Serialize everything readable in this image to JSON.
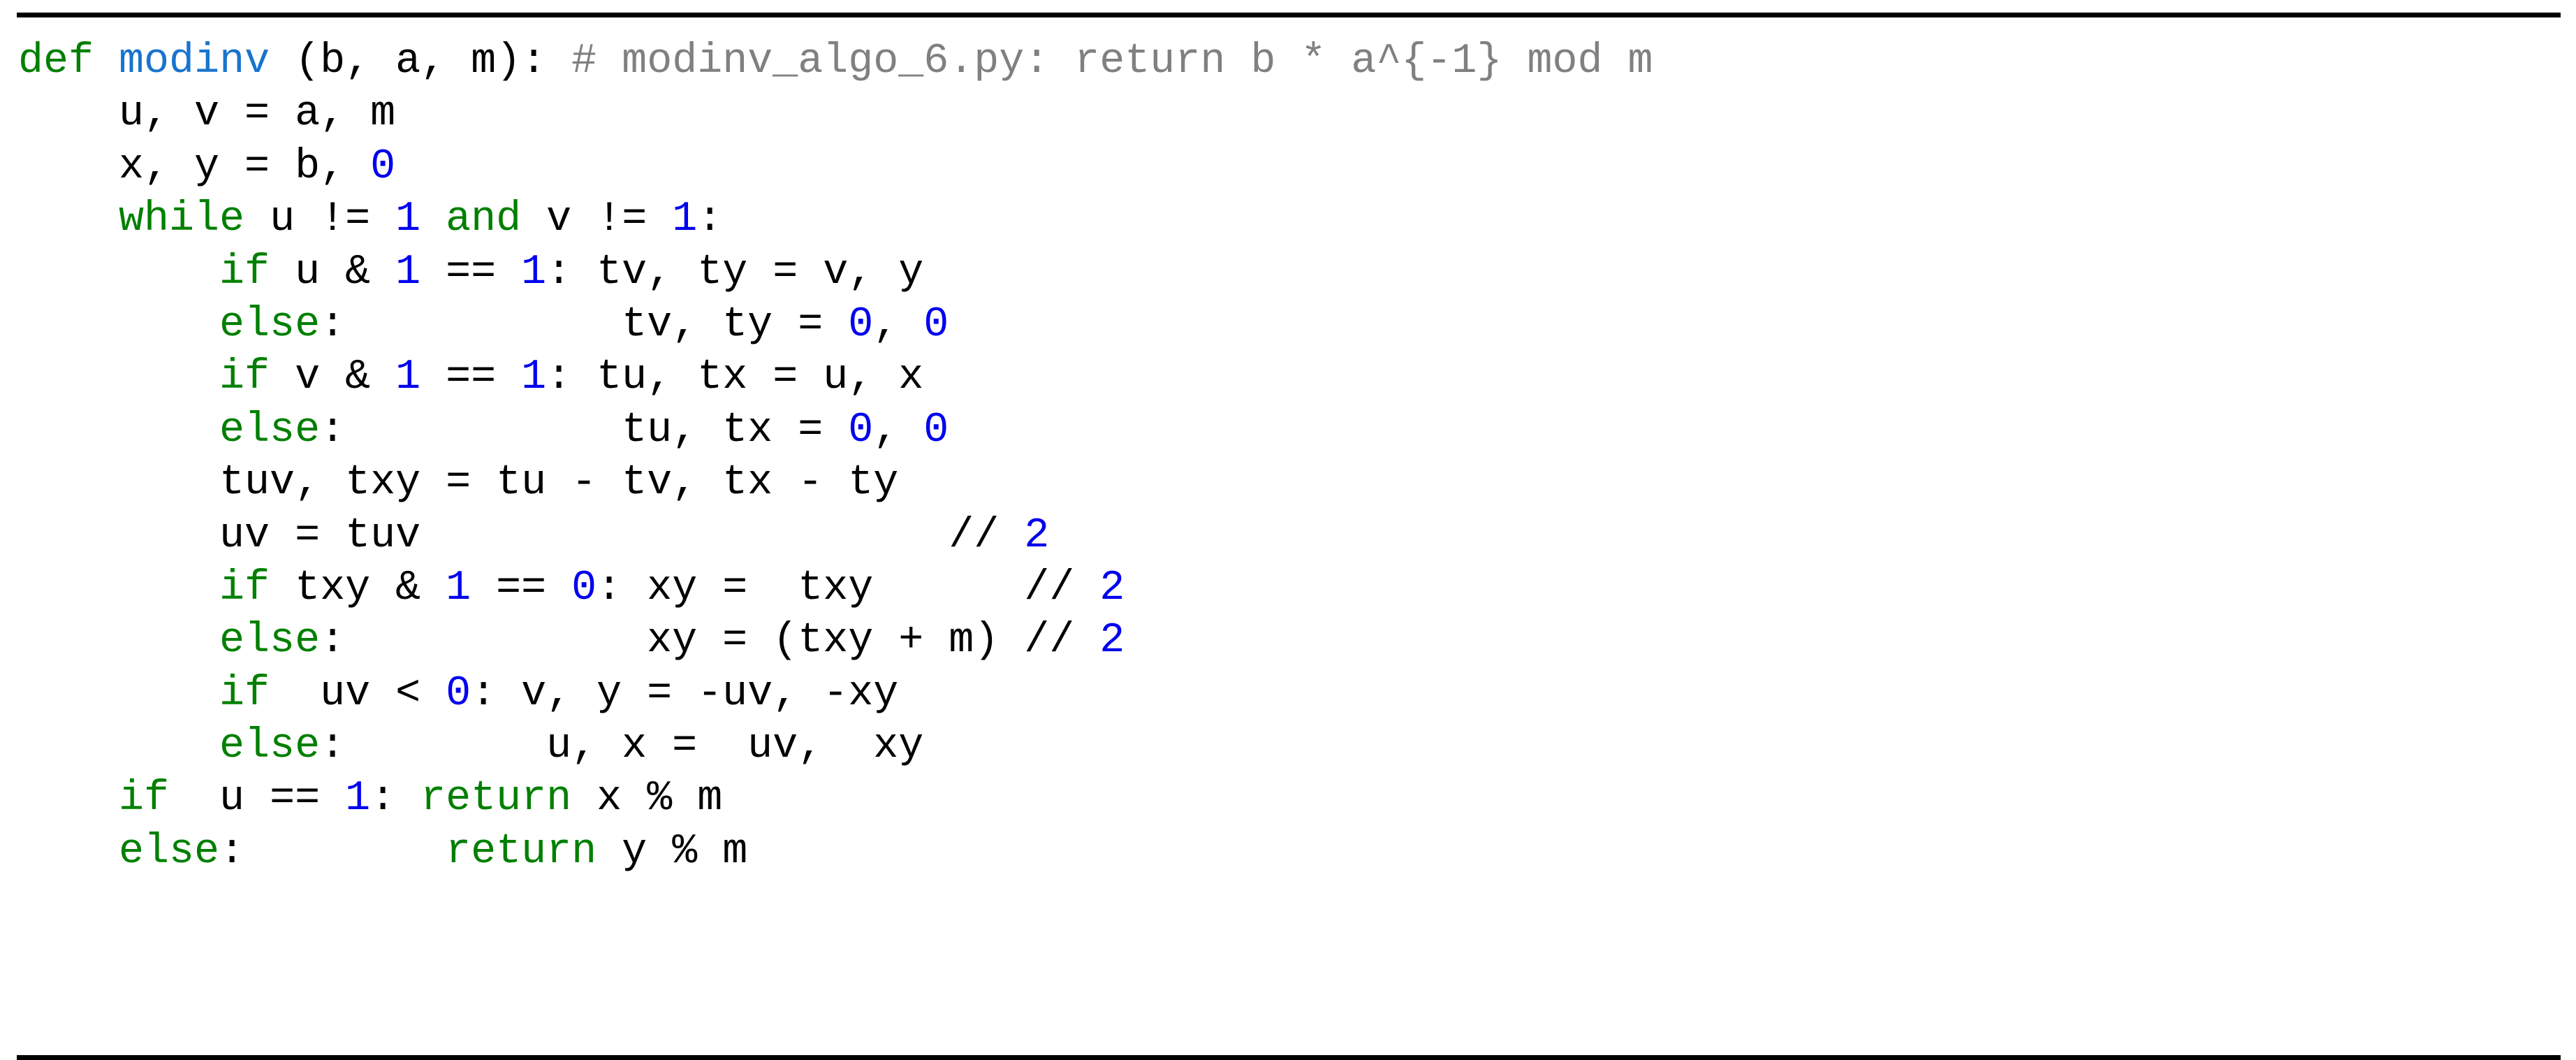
{
  "listing": {
    "language": "python",
    "caption": "",
    "colors": {
      "keyword": "#007f00",
      "function_name": "#1874cd",
      "number": "#0000ee",
      "comment": "#808080",
      "identifier": "#000000",
      "rule": "#000000",
      "background": "#ffffff"
    },
    "rules": {
      "top": "─",
      "bottom": "─"
    },
    "lines": [
      {
        "id": "line-1",
        "indent": 0,
        "tokens": [
          {
            "t": "def",
            "c": "kw"
          },
          {
            "t": " ",
            "c": "op"
          },
          {
            "t": "modinv",
            "c": "fn"
          },
          {
            "t": " (b, a, m): ",
            "c": "op"
          },
          {
            "t": "# modinv_algo_6.py: return b * a^{-1} mod m",
            "c": "cmt"
          }
        ],
        "plain": "def modinv (b, a, m): # modinv_algo_6.py: return b * a^{-1} mod m"
      },
      {
        "id": "line-2",
        "indent": 1,
        "tokens": [
          {
            "t": "u, v = a, m",
            "c": "op"
          }
        ],
        "plain": "    u, v = a, m"
      },
      {
        "id": "line-3",
        "indent": 1,
        "tokens": [
          {
            "t": "x, y = b, ",
            "c": "op"
          },
          {
            "t": "0",
            "c": "num"
          }
        ],
        "plain": "    x, y = b, 0"
      },
      {
        "id": "line-4",
        "indent": 1,
        "tokens": [
          {
            "t": "while",
            "c": "kw"
          },
          {
            "t": " u != ",
            "c": "op"
          },
          {
            "t": "1",
            "c": "num"
          },
          {
            "t": " ",
            "c": "op"
          },
          {
            "t": "and",
            "c": "kw"
          },
          {
            "t": " v != ",
            "c": "op"
          },
          {
            "t": "1",
            "c": "num"
          },
          {
            "t": ":",
            "c": "op"
          }
        ],
        "plain": "    while u != 1 and v != 1:"
      },
      {
        "id": "line-5",
        "indent": 2,
        "tokens": [
          {
            "t": "if",
            "c": "kw"
          },
          {
            "t": " u & ",
            "c": "op"
          },
          {
            "t": "1",
            "c": "num"
          },
          {
            "t": " == ",
            "c": "op"
          },
          {
            "t": "1",
            "c": "num"
          },
          {
            "t": ": tv, ty = v, y",
            "c": "op"
          }
        ],
        "plain": "        if u & 1 == 1: tv, ty = v, y"
      },
      {
        "id": "line-6",
        "indent": 2,
        "tokens": [
          {
            "t": "else",
            "c": "kw"
          },
          {
            "t": ":           tv, ty = ",
            "c": "op"
          },
          {
            "t": "0",
            "c": "num"
          },
          {
            "t": ", ",
            "c": "op"
          },
          {
            "t": "0",
            "c": "num"
          }
        ],
        "plain": "        else:           tv, ty = 0, 0"
      },
      {
        "id": "line-7",
        "indent": 2,
        "tokens": [
          {
            "t": "if",
            "c": "kw"
          },
          {
            "t": " v & ",
            "c": "op"
          },
          {
            "t": "1",
            "c": "num"
          },
          {
            "t": " == ",
            "c": "op"
          },
          {
            "t": "1",
            "c": "num"
          },
          {
            "t": ": tu, tx = u, x",
            "c": "op"
          }
        ],
        "plain": "        if v & 1 == 1: tu, tx = u, x"
      },
      {
        "id": "line-8",
        "indent": 2,
        "tokens": [
          {
            "t": "else",
            "c": "kw"
          },
          {
            "t": ":           tu, tx = ",
            "c": "op"
          },
          {
            "t": "0",
            "c": "num"
          },
          {
            "t": ", ",
            "c": "op"
          },
          {
            "t": "0",
            "c": "num"
          }
        ],
        "plain": "        else:           tu, tx = 0, 0"
      },
      {
        "id": "line-9",
        "indent": 2,
        "tokens": [
          {
            "t": "tuv, txy = tu - tv, tx - ty",
            "c": "op"
          }
        ],
        "plain": "        tuv, txy = tu - tv, tx - ty"
      },
      {
        "id": "line-10",
        "indent": 2,
        "tokens": [
          {
            "t": "uv = tuv                     // ",
            "c": "op"
          },
          {
            "t": "2",
            "c": "num"
          }
        ],
        "plain": "        uv = tuv                     // 2"
      },
      {
        "id": "line-11",
        "indent": 2,
        "tokens": [
          {
            "t": "if",
            "c": "kw"
          },
          {
            "t": " txy & ",
            "c": "op"
          },
          {
            "t": "1",
            "c": "num"
          },
          {
            "t": " == ",
            "c": "op"
          },
          {
            "t": "0",
            "c": "num"
          },
          {
            "t": ": xy =  txy      // ",
            "c": "op"
          },
          {
            "t": "2",
            "c": "num"
          }
        ],
        "plain": "        if txy & 1 == 0: xy =  txy      // 2"
      },
      {
        "id": "line-12",
        "indent": 2,
        "tokens": [
          {
            "t": "else",
            "c": "kw"
          },
          {
            "t": ":            xy = (txy + m) // ",
            "c": "op"
          },
          {
            "t": "2",
            "c": "num"
          }
        ],
        "plain": "        else:            xy = (txy + m) // 2"
      },
      {
        "id": "line-13",
        "indent": 2,
        "tokens": [
          {
            "t": "if",
            "c": "kw"
          },
          {
            "t": "  uv < ",
            "c": "op"
          },
          {
            "t": "0",
            "c": "num"
          },
          {
            "t": ": v, y = -uv, -xy",
            "c": "op"
          }
        ],
        "plain": "        if  uv < 0: v, y = -uv, -xy"
      },
      {
        "id": "line-14",
        "indent": 2,
        "tokens": [
          {
            "t": "else",
            "c": "kw"
          },
          {
            "t": ":        u, x =  uv,  xy",
            "c": "op"
          }
        ],
        "plain": "        else:        u, x =  uv,  xy"
      },
      {
        "id": "line-15",
        "indent": 1,
        "tokens": [
          {
            "t": "if",
            "c": "kw"
          },
          {
            "t": "  u == ",
            "c": "op"
          },
          {
            "t": "1",
            "c": "num"
          },
          {
            "t": ": ",
            "c": "op"
          },
          {
            "t": "return",
            "c": "kw"
          },
          {
            "t": " x % m",
            "c": "op"
          }
        ],
        "plain": "    if  u == 1: return x % m"
      },
      {
        "id": "line-16",
        "indent": 1,
        "tokens": [
          {
            "t": "else",
            "c": "kw"
          },
          {
            "t": ":        ",
            "c": "op"
          },
          {
            "t": "return",
            "c": "kw"
          },
          {
            "t": " y % m",
            "c": "op"
          }
        ],
        "plain": "    else:        return y % m"
      }
    ]
  }
}
